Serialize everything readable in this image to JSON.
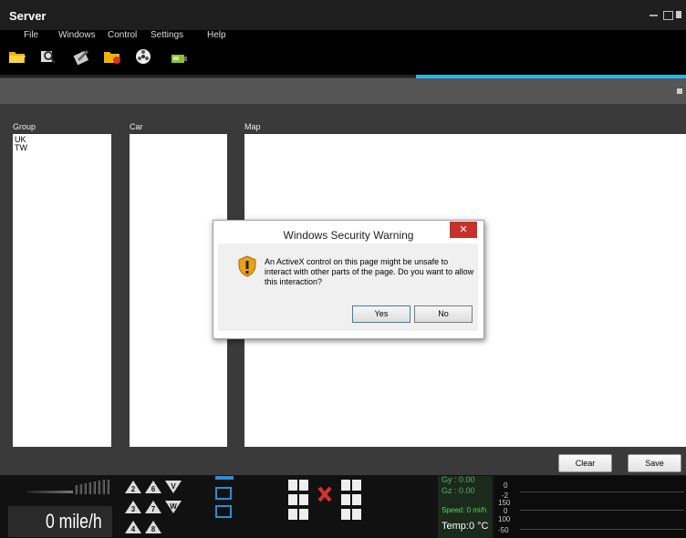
{
  "window": {
    "title": "Server"
  },
  "menu": [
    "File",
    "Windows",
    "Control",
    "Settings",
    "Help"
  ],
  "toolbar": {
    "icons": [
      "open-folder-icon",
      "search-icon",
      "edit-icon",
      "folder-delete-icon",
      "film-reel-icon",
      "device-icon"
    ]
  },
  "panels": {
    "group": {
      "label": "Group",
      "items": [
        "UK",
        "TW"
      ]
    },
    "car": {
      "label": "Car"
    },
    "map": {
      "label": "Map"
    }
  },
  "buttons": {
    "clear": "Clear",
    "save": "Save"
  },
  "dashboard": {
    "speed": "0 mile/h",
    "gy": "Gy :  0.00",
    "gz": "Gz :  0.00",
    "speed_small": "Speed: 0 mi/h",
    "temp": "Temp:0 °C",
    "gauge_ticks": [
      "0",
      "-2",
      "150",
      "0",
      "100",
      "-50"
    ],
    "gear_labels": [
      "2",
      "6",
      "V",
      "3",
      "7",
      "W",
      "4",
      "8"
    ]
  },
  "dialog": {
    "title": "Windows Security Warning",
    "close": "✕",
    "message": "An ActiveX control on this page might be unsafe to interact with other parts of the page. Do you want to allow this interaction?",
    "yes": "Yes",
    "no": "No"
  },
  "colors": {
    "accent": "#2ab3e6",
    "close_red": "#c7312b",
    "gauge_green": "#5ad35a"
  }
}
